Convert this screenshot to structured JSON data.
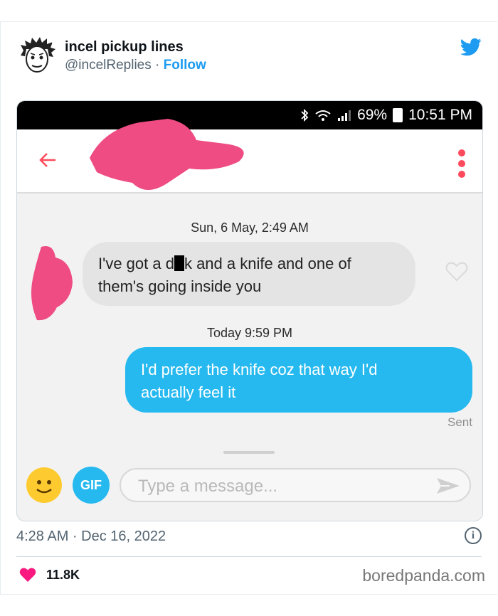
{
  "tweet": {
    "author_name": "incel pickup lines",
    "handle": "@incelReplies",
    "separator": " · ",
    "follow_label": "Follow",
    "timestamp": "4:28 AM · Dec 16, 2022",
    "likes": "11.8K"
  },
  "phone": {
    "status": {
      "battery": "69%",
      "time": "10:51 PM"
    },
    "messages": [
      {
        "date": "Sun, 6 May, 2:49 AM",
        "text_before_mask": "I've got a d",
        "text_after_mask": "k and a knife and one of",
        "text_line2": "them's going inside you",
        "direction": "incoming"
      },
      {
        "date": "Today 9:59 PM",
        "text_line1": "I'd prefer the knife coz that way I'd",
        "text_line2": "actually feel it",
        "direction": "outgoing",
        "status": "Sent"
      }
    ],
    "composer": {
      "gif_label": "GIF",
      "placeholder": "Type a message..."
    }
  },
  "colors": {
    "twitter_blue": "#1d9bf0",
    "bubble_blue": "#26b9ef",
    "tinder_red": "#fd4a5c",
    "redaction_pink": "#ee4c83"
  },
  "watermark": "boredpanda.com"
}
